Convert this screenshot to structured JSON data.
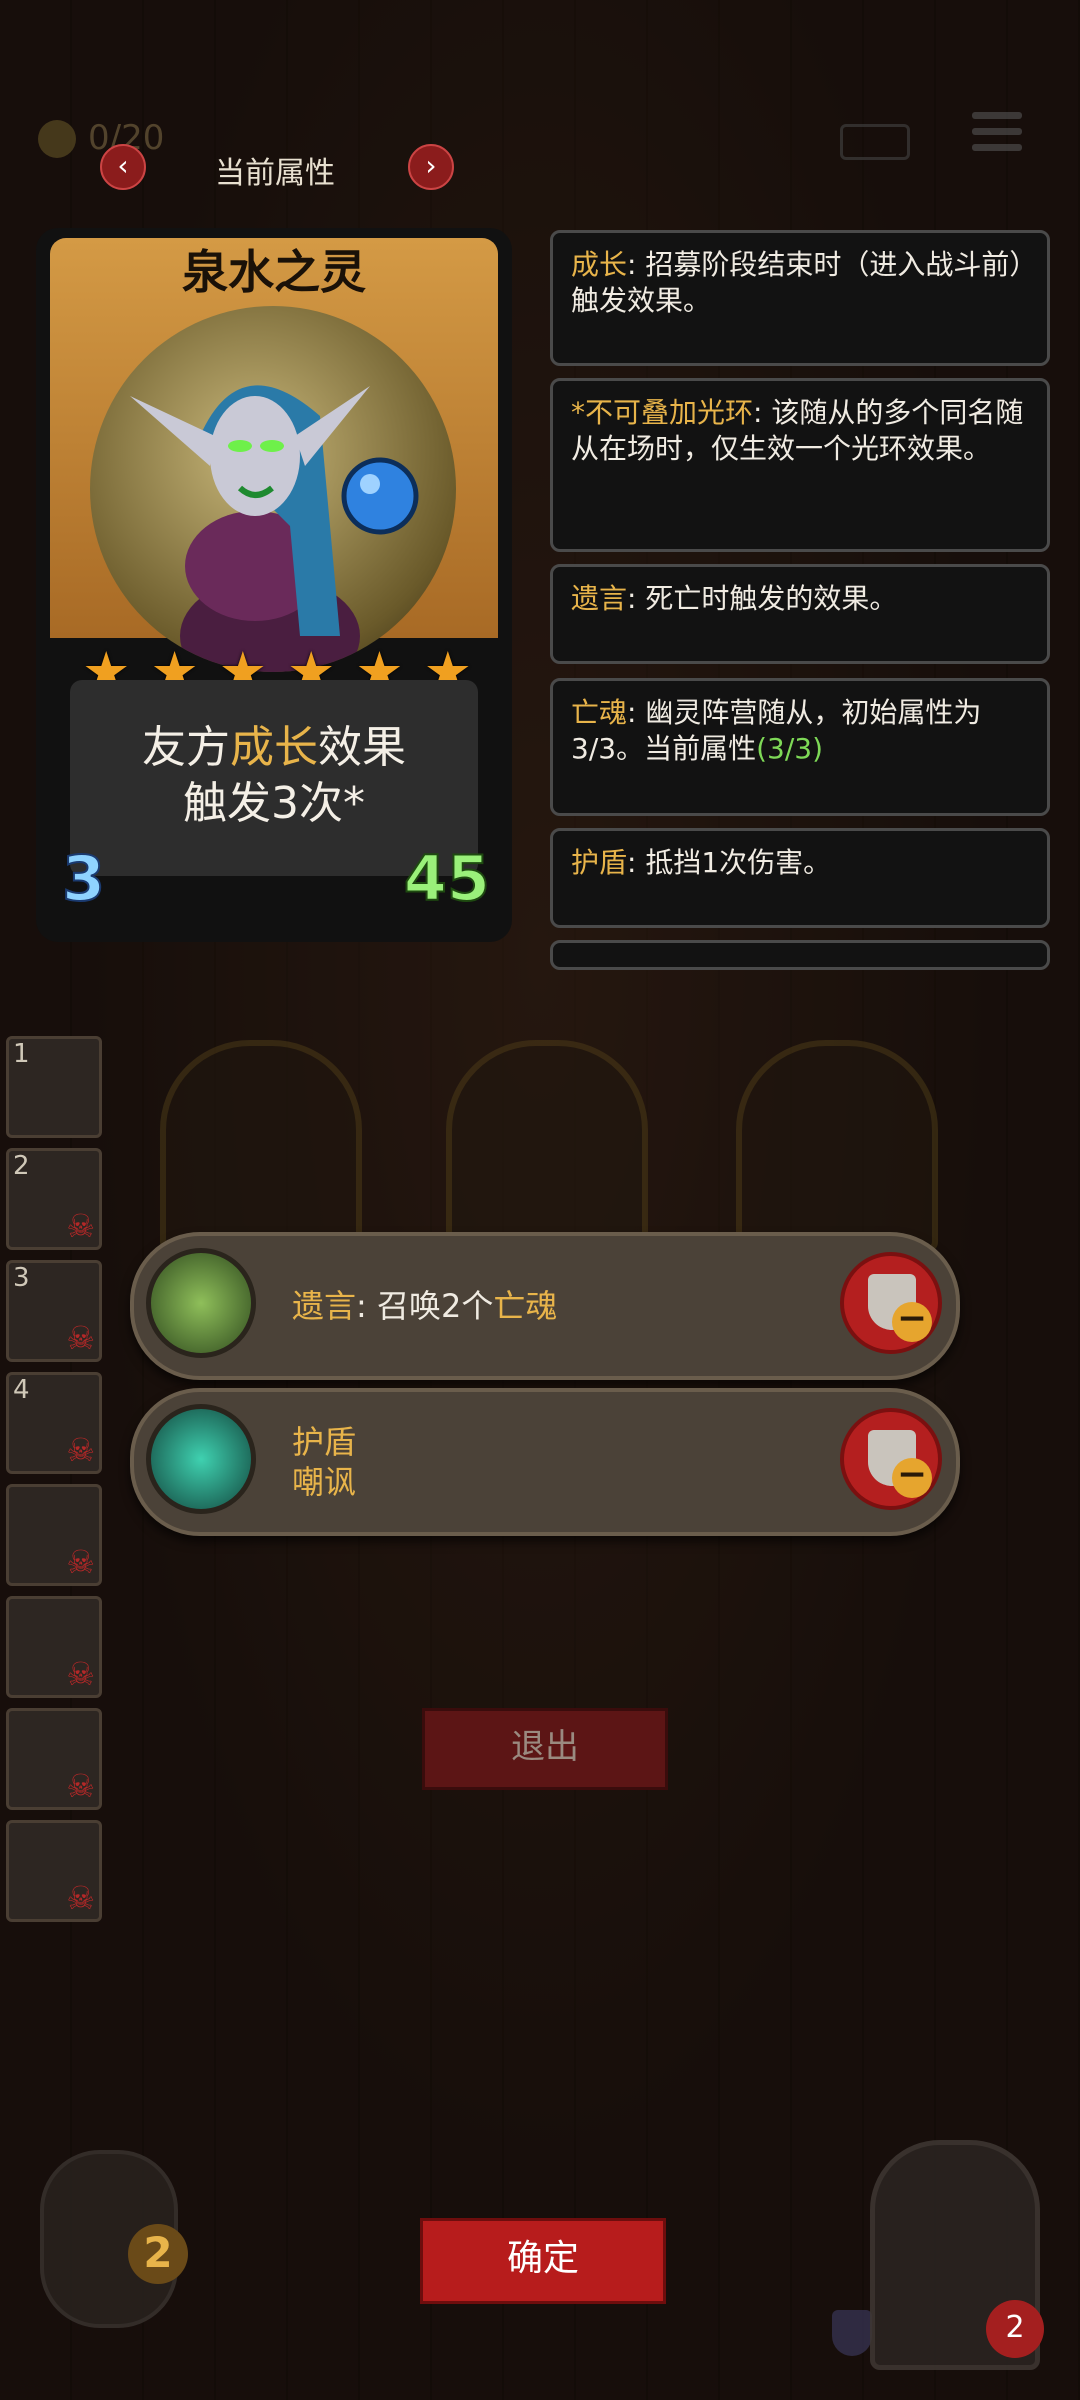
{
  "top": {
    "coin_text": "0/20",
    "title": "当前属性",
    "prev_icon": "chevron-left-icon",
    "next_icon": "chevron-right-icon"
  },
  "card": {
    "name": "泉水之灵",
    "stars": 6,
    "desc_prefix": "友方",
    "desc_highlight": "成长",
    "desc_suffix": "效果",
    "desc_line2": "触发3次*",
    "cost": "3",
    "power": "45"
  },
  "keywords": [
    {
      "key": "成长",
      "text": ": 招募阶段结束时（进入战斗前）触发效果。"
    },
    {
      "key": "*不可叠加光环",
      "text": ": 该随从的多个同名随从在场时，仅生效一个光环效果。"
    },
    {
      "key": "遗言",
      "text": ": 死亡时触发的效果。"
    },
    {
      "key": "亡魂",
      "text": ": 幽灵阵营随从，初始属性为3/3。当前属性",
      "green": "(3/3)"
    },
    {
      "key": "护盾",
      "text": ": 抵挡1次伤害。"
    }
  ],
  "slots": [
    "1",
    "2",
    "3",
    "4",
    "",
    "",
    "",
    ""
  ],
  "rows": [
    {
      "label": "遗言",
      "sep": ": ",
      "text": "召唤2个",
      "hl": "亡魂"
    },
    {
      "line1": "护盾",
      "line2": "嘲讽"
    }
  ],
  "buttons": {
    "exit": "退出",
    "confirm": "确定"
  },
  "bottom": {
    "coins": "2",
    "health": "2"
  },
  "colors": {
    "gold": "#e8b44a",
    "green": "#7ed957",
    "red_button": "#b71c1c"
  }
}
